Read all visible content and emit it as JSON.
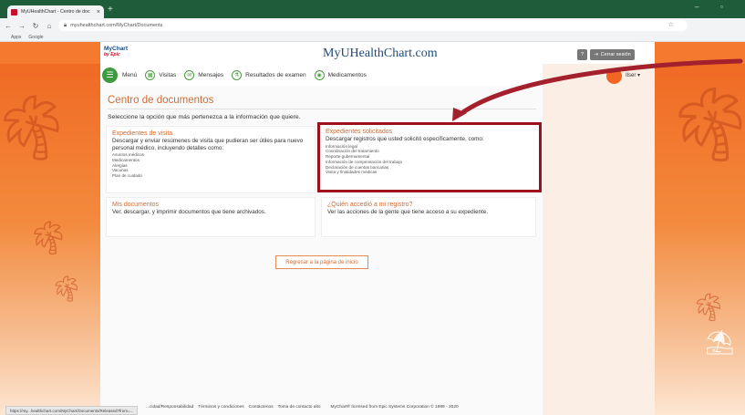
{
  "browser": {
    "tab_title": "MyUHealthChart - Centro de doc",
    "tab_close": "×",
    "new_tab": "+",
    "url": "myuhealthchart.com/MyChart/Documents",
    "bookmarks": [
      "Apps",
      "Google"
    ],
    "status_url": "https://my...healthchart.com/MyChart/Documents/Released?from=..."
  },
  "header": {
    "mychart_logo": "MyChart",
    "epic_label": "by Epic",
    "brand": "MyUHealthChart.com",
    "help_label": "?",
    "logout_label": "Cerrar sesión"
  },
  "menu": {
    "items": [
      {
        "label": "Menú",
        "icon": "hamburger-icon"
      },
      {
        "label": "Visitas",
        "icon": "calendar-icon"
      },
      {
        "label": "Mensajes",
        "icon": "envelope-icon"
      },
      {
        "label": "Resultados de examen",
        "icon": "flask-icon"
      },
      {
        "label": "Medicamentos",
        "icon": "pill-icon"
      }
    ],
    "user_name": "Ilser"
  },
  "page": {
    "title": "Centro de documentos",
    "instructions": "Seleccione la opción que más pertenezca a la información que quiere.",
    "cards": [
      {
        "title": "Expedientes de visita",
        "desc": "Descargar y enviar resúmenes de visita que pudieran ser útiles para nuevo personal médico, incluyendo detalles como:",
        "list": [
          "Asuntos médicos",
          "Medicamentos",
          "Alergias",
          "Vacunas",
          "Plan de cuidado"
        ]
      },
      {
        "title": "Expedientes solicitados",
        "desc": "Descargar registros que usted solicitó específicamente, como:",
        "list": [
          "Información legal",
          "Coordinación del tratamiento",
          "Reporte gubernamental",
          "Información de compensación del trabajo",
          "Declaración de cuentas bancarias",
          "Visita y finalidades médicas"
        ]
      },
      {
        "title": "Mis documentos",
        "desc": "Ver, descargar, y imprimir documentos que tiene archivados."
      },
      {
        "title": "¿Quién accedió a mi registro?",
        "desc": "Ver las acciones de la gente que tiene acceso a su expediente."
      }
    ],
    "home_button": "Regresar a la página de inicio"
  },
  "footer": {
    "links": [
      "...cidad/Responsabilidad",
      "Términos y condiciones",
      "Contáctenos",
      "Toma de contacto alto"
    ],
    "copyright": "MyChart® licensed from Epic Systems Corporation © 1999 - 2020"
  },
  "colors": {
    "accent_orange": "#d36a2f",
    "highlight_red": "#a00f1c",
    "menu_green": "#3f9a3f",
    "chrome_green": "#1f5d3a"
  }
}
